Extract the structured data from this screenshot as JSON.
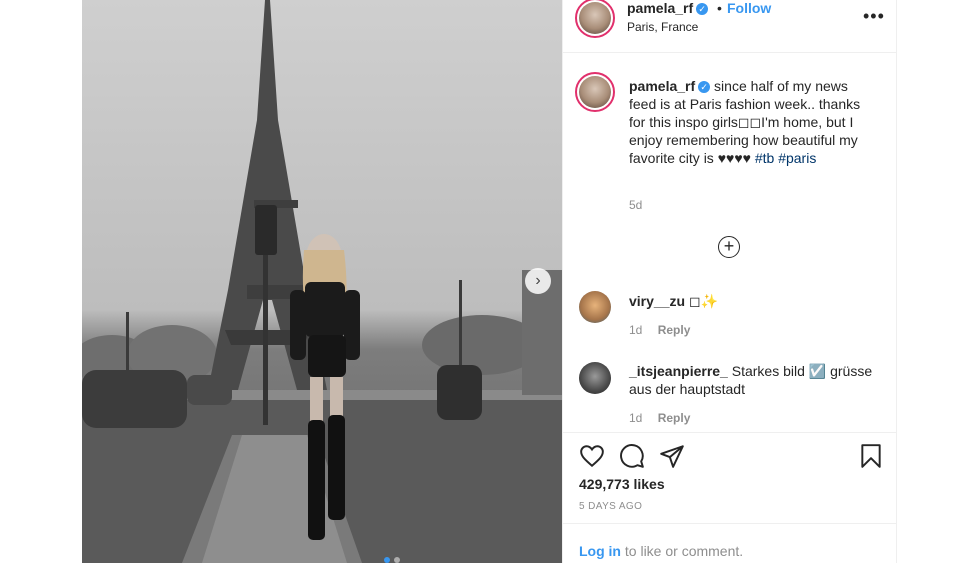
{
  "post": {
    "username": "pamela_rf",
    "follow_label": "Follow",
    "separator": "•",
    "location": "Paris, France",
    "more_icon": "more-horizontal-icon",
    "verified_mark": "✓"
  },
  "caption": {
    "username": "pamela_rf",
    "text": "since half of my news feed is at Paris fashion week.. thanks for this inspo girls◻◻I'm home, but I enjoy remembering how beautiful my favorite city is ♥♥♥♥",
    "hashtags": [
      "#tb",
      "#paris"
    ],
    "age": "5d"
  },
  "load_more_icon": "plus-circle-icon",
  "comments": [
    {
      "username": "viry__zu",
      "text": "◻✨",
      "age": "1d",
      "reply_label": "Reply"
    },
    {
      "username": "_itsjeanpierre_",
      "text": "Starkes bild ☑️ grüsse aus der hauptstadt",
      "age": "1d",
      "reply_label": "Reply"
    }
  ],
  "actions": {
    "like_icon": "heart-icon",
    "comment_icon": "comment-icon",
    "share_icon": "share-icon",
    "save_icon": "bookmark-icon"
  },
  "likes": "429,773 likes",
  "timestamp": "5 DAYS AGO",
  "login": {
    "link": "Log in",
    "rest": "to like or comment."
  },
  "carousel": {
    "next_icon": "chevron-right-icon",
    "slide_count": 2,
    "active_index": 0
  },
  "colors": {
    "link": "#3897f0",
    "hashtag": "#003569",
    "muted": "#8e8e8e",
    "ring": "#e1306c"
  }
}
